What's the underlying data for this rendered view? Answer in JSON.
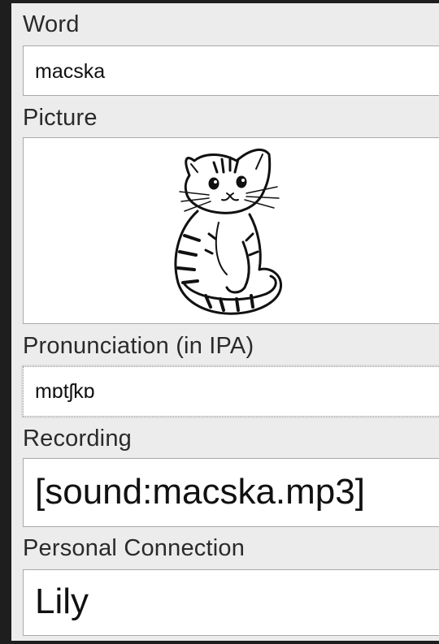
{
  "fields": {
    "word": {
      "label": "Word",
      "value": "macska"
    },
    "picture": {
      "label": "Picture",
      "image_icon": "cat-sketch-image"
    },
    "pronunciation": {
      "label": "Pronunciation (in IPA)",
      "value": "mɒtʃkɒ"
    },
    "recording": {
      "label": "Recording",
      "value": "[sound:macska.mp3]"
    },
    "personal_connection": {
      "label": "Personal Connection",
      "value": "Lily"
    }
  }
}
